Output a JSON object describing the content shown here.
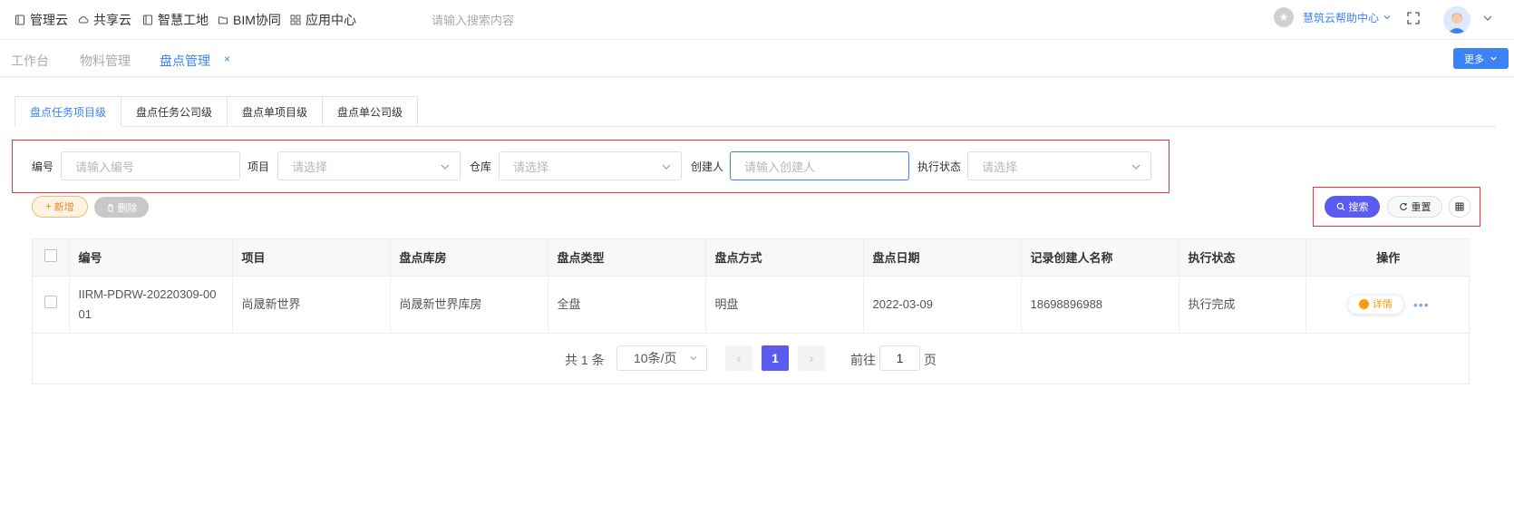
{
  "topnav": {
    "items": [
      {
        "label": "管理云",
        "icon": "book-icon"
      },
      {
        "label": "共享云",
        "icon": "cloud-icon"
      },
      {
        "label": "智慧工地",
        "icon": "book-icon"
      },
      {
        "label": "BIM协同",
        "icon": "folder-icon"
      },
      {
        "label": "应用中心",
        "icon": "grid-icon"
      }
    ],
    "search_placeholder": "请输入搜索内容",
    "help_label": "慧筑云帮助中心"
  },
  "pagetabs": {
    "items": [
      {
        "label": "工作台",
        "active": false
      },
      {
        "label": "物料管理",
        "active": false
      },
      {
        "label": "盘点管理",
        "active": true
      }
    ],
    "close": "×",
    "more_label": "更多"
  },
  "subtabs": [
    {
      "label": "盘点任务项目级",
      "active": true
    },
    {
      "label": "盘点任务公司级",
      "active": false
    },
    {
      "label": "盘点单项目级",
      "active": false
    },
    {
      "label": "盘点单公司级",
      "active": false
    }
  ],
  "filters": {
    "code": {
      "label": "编号",
      "placeholder": "请输入编号"
    },
    "project": {
      "label": "项目",
      "placeholder": "请选择"
    },
    "warehouse": {
      "label": "仓库",
      "placeholder": "请选择"
    },
    "creator": {
      "label": "创建人",
      "placeholder": "请输入创建人"
    },
    "status": {
      "label": "执行状态",
      "placeholder": "请选择"
    }
  },
  "actions": {
    "add": "新增",
    "delete": "删除",
    "search": "搜索",
    "reset": "重置"
  },
  "table": {
    "headers": [
      "编号",
      "项目",
      "盘点库房",
      "盘点类型",
      "盘点方式",
      "盘点日期",
      "记录创建人名称",
      "执行状态",
      "操作"
    ],
    "rows": [
      {
        "code": "IIRM-PDRW-20220309-0001",
        "project": "尚晟新世界",
        "warehouse": "尚晟新世界库房",
        "type": "全盘",
        "method": "明盘",
        "date": "2022-03-09",
        "creator": "18698896988",
        "status": "执行完成",
        "detail": "详情"
      }
    ]
  },
  "pagination": {
    "total": "共 1 条",
    "page_size": "10条/页",
    "current": "1",
    "goto_label": "前往",
    "goto_value": "1",
    "page_word": "页"
  },
  "colors": {
    "primary": "#3b82f6",
    "accent_purple": "#5b5bf0",
    "warning": "#f59e0b",
    "highlight_red": "#e53935"
  }
}
